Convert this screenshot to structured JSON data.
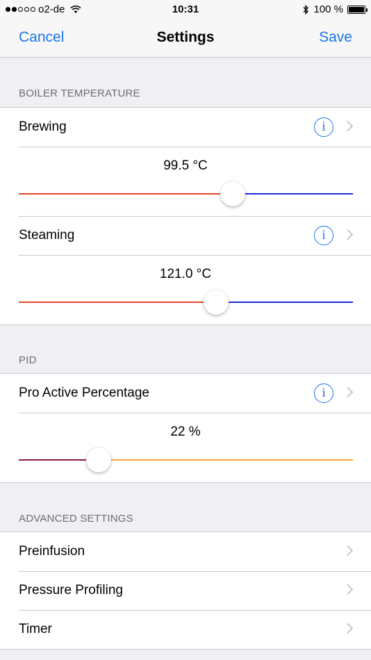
{
  "status_bar": {
    "carrier": "o2-de",
    "time": "10:31",
    "battery": "100 %"
  },
  "nav": {
    "cancel": "Cancel",
    "title": "Settings",
    "save": "Save"
  },
  "sections": {
    "boiler": {
      "header": "BOILER TEMPERATURE",
      "brewing": {
        "label": "Brewing",
        "value": "99.5 °C",
        "fraction": 0.64,
        "min_color": "#e1442b",
        "max_color": "#1d28d6"
      },
      "steaming": {
        "label": "Steaming",
        "value": "121.0 °C",
        "fraction": 0.59,
        "min_color": "#e1442b",
        "max_color": "#1d28d6"
      }
    },
    "pid": {
      "header": "PID",
      "pro_active": {
        "label": "Pro Active Percentage",
        "value": "22 %",
        "fraction": 0.24,
        "min_color": "#8a1b3f",
        "max_color": "#f0a23a"
      }
    },
    "advanced": {
      "header": "ADVANCED SETTINGS",
      "items": [
        "Preinfusion",
        "Pressure Profiling",
        "Timer"
      ]
    }
  },
  "colors": {
    "accent": "#1a75e8",
    "background": "#efeff4"
  },
  "icons": {
    "info": "info-icon",
    "chevron": "chevron-right-icon"
  }
}
